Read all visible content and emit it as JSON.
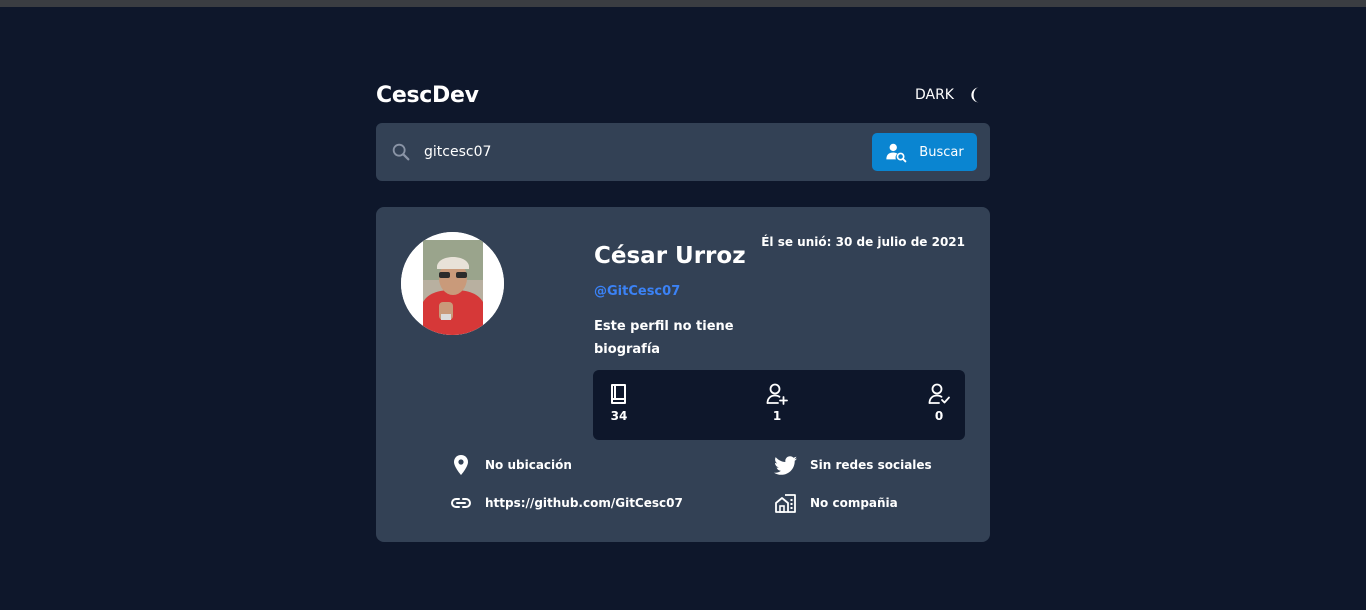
{
  "header": {
    "logo": "CescDev",
    "theme_label": "DARK",
    "theme_icon": "moon-icon"
  },
  "search": {
    "value": "gitcesc07",
    "placeholder": "",
    "button_label": "Buscar",
    "button_color": "#0a85d1"
  },
  "profile": {
    "name": "César Urroz",
    "joined": "Él se unió: 30 de julio de 2021",
    "login": "@GitCesc07",
    "bio": "Este perfil no tiene biografía",
    "stats": {
      "repos": "34",
      "followers": "1",
      "following": "0"
    },
    "info": {
      "location": "No ubicación",
      "blog": "https://github.com/GitCesc07",
      "twitter": "Sin redes sociales",
      "company": "No compañia"
    }
  },
  "colors": {
    "background": "#0e172b",
    "card": "#334155",
    "accent": "#3b82f6"
  }
}
